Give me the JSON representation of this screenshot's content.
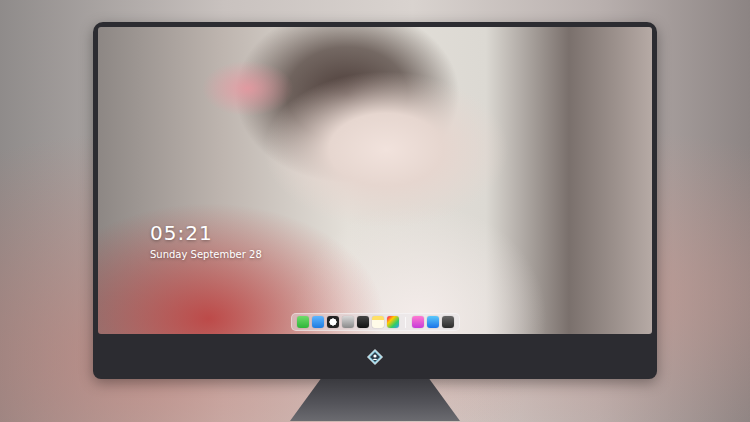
{
  "clock": {
    "time": "05:21",
    "date": "Sunday September 28"
  }
}
